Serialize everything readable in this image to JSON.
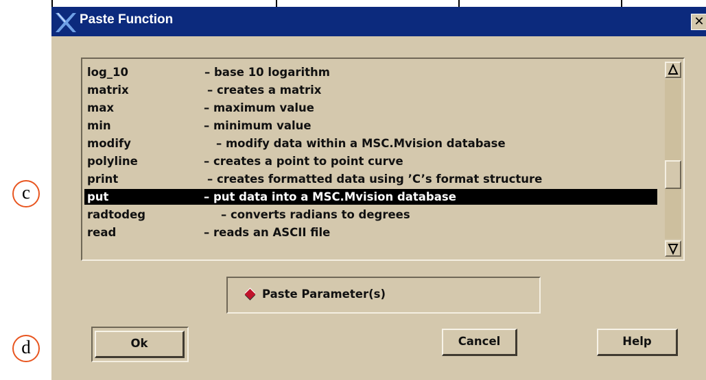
{
  "window": {
    "title": "Paste Function",
    "close_glyph": "✕"
  },
  "annotations": [
    "c",
    "d"
  ],
  "function_list": {
    "rows": [
      {
        "name": "log_10",
        "desc": "– base 10 logarithm",
        "selected": false
      },
      {
        "name": "matrix",
        "desc": "– creates a matrix",
        "selected": false
      },
      {
        "name": "max",
        "desc": "– maximum value",
        "selected": false
      },
      {
        "name": "min",
        "desc": "– minimum value",
        "selected": false
      },
      {
        "name": "modify",
        "desc": "– modify data within a MSC.Mvision database",
        "selected": false
      },
      {
        "name": "polyline",
        "desc": "– creates a point to point curve",
        "selected": false
      },
      {
        "name": "print",
        "desc": "– creates formatted data using ’C’s format structure",
        "selected": false
      },
      {
        "name": "put",
        "desc": "– put data into a MSC.Mvision database",
        "selected": true
      },
      {
        "name": "radtodeg",
        "desc": "– converts radians to degrees",
        "selected": false
      },
      {
        "name": "read",
        "desc": "– reads an ASCII file",
        "selected": false
      }
    ],
    "scroll_position_fraction": 0.62
  },
  "paste_parameters": {
    "label": "Paste Parameter(s)",
    "selected": true
  },
  "buttons": {
    "ok": "Ok",
    "cancel": "Cancel",
    "help": "Help"
  },
  "colors": {
    "dialog_bg": "#d4c8ad",
    "titlebar_bg": "#0c2a7d",
    "selection_bg": "#000000",
    "toggle_indicator": "#c0142c",
    "annotation_ring": "#e8551f"
  }
}
